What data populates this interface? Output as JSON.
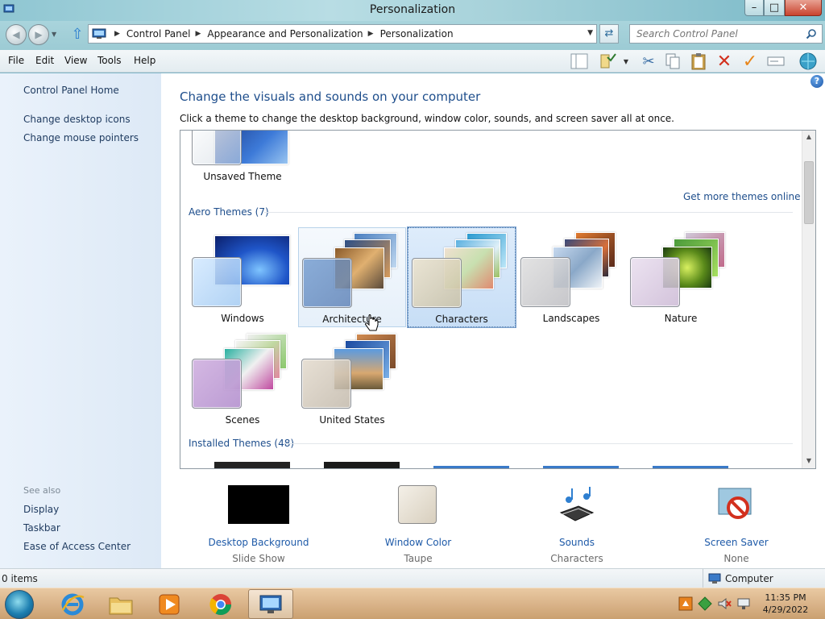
{
  "window": {
    "title": "Personalization"
  },
  "address": {
    "crumbs": [
      "Control Panel",
      "Appearance and Personalization",
      "Personalization"
    ],
    "search_placeholder": "Search Control Panel"
  },
  "menu": [
    "File",
    "Edit",
    "View",
    "Tools",
    "Help"
  ],
  "toolbar_icons": [
    "pane-icon",
    "properties-icon",
    "cut-icon",
    "copy-icon",
    "paste-icon",
    "delete-icon",
    "check-icon",
    "rename-icon",
    "network-icon"
  ],
  "leftpane": {
    "links": [
      "Control Panel Home",
      "Change desktop icons",
      "Change mouse pointers"
    ],
    "see_also_label": "See also",
    "see_also": [
      "Display",
      "Taskbar",
      "Ease of Access Center"
    ]
  },
  "main": {
    "title": "Change the visuals and sounds on your computer",
    "description": "Click a theme to change the desktop background, window color, sounds, and screen saver all at once.",
    "unsaved_theme": "Unsaved Theme",
    "get_more_link": "Get more themes online",
    "aero_group": "Aero Themes (7)",
    "installed_group": "Installed Themes (48)",
    "themes": [
      {
        "name": "Windows",
        "state": "normal"
      },
      {
        "name": "Architecture",
        "state": "hover"
      },
      {
        "name": "Characters",
        "state": "selected"
      },
      {
        "name": "Landscapes",
        "state": "normal"
      },
      {
        "name": "Nature",
        "state": "normal"
      },
      {
        "name": "Scenes",
        "state": "normal"
      },
      {
        "name": "United States",
        "state": "normal"
      }
    ]
  },
  "settings": [
    {
      "name": "Desktop Background",
      "value": "Slide Show"
    },
    {
      "name": "Window Color",
      "value": "Taupe"
    },
    {
      "name": "Sounds",
      "value": "Characters"
    },
    {
      "name": "Screen Saver",
      "value": "None"
    }
  ],
  "status": {
    "items": "0 items",
    "location": "Computer"
  },
  "taskbar": {
    "time": "11:35 PM",
    "date": "4/29/2022"
  },
  "colors": {
    "link": "#1e4e8c",
    "window_chrome": "#a9d4dc",
    "taskbar": "#d7b085"
  }
}
